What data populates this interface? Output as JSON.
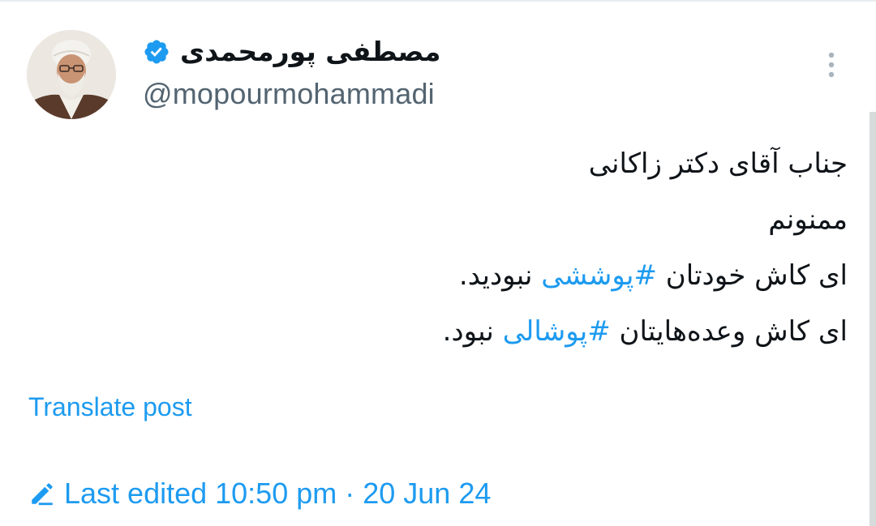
{
  "post": {
    "author": {
      "display_name": "مصطفی پورمحمدی",
      "handle": "@mopourmohammadi",
      "verified": true
    },
    "text_lines": [
      {
        "segments": [
          {
            "text": "جناب آقای دکتر زاکانی",
            "hashtag": false
          }
        ]
      },
      {
        "segments": [
          {
            "text": "ممنونم",
            "hashtag": false
          }
        ]
      },
      {
        "segments": [
          {
            "text": "ای کاش خودتان ",
            "hashtag": false
          },
          {
            "text": "#پوششی",
            "hashtag": true
          },
          {
            "text": " نبودید.",
            "hashtag": false
          }
        ]
      },
      {
        "segments": [
          {
            "text": "ای کاش وعده‌هایتان ",
            "hashtag": false
          },
          {
            "text": "#پوشالی",
            "hashtag": true
          },
          {
            "text": " نبود.",
            "hashtag": false
          }
        ]
      }
    ],
    "translate_label": "Translate post",
    "edited_label": "Last edited 10:50 pm · 20 Jun 24"
  },
  "icons": {
    "verified": "verified-badge-icon",
    "more": "more-vertical-icon",
    "edited": "pencil-icon"
  },
  "colors": {
    "link": "#1d9bf0",
    "text": "#0f1419",
    "secondary": "#536471",
    "verified": "#1d9bf0"
  }
}
